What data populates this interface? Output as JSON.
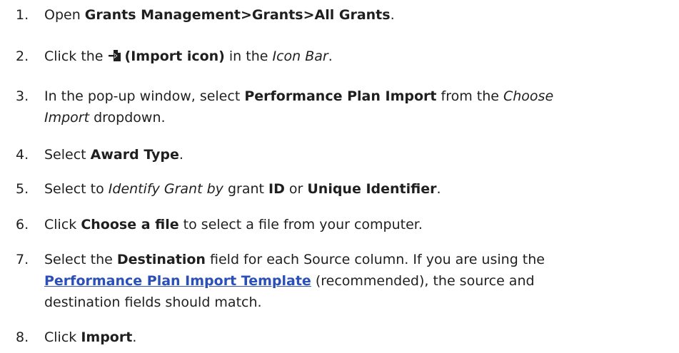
{
  "steps": [
    {
      "number": "1.",
      "pre": "Open ",
      "bold": "Grants Management>Grants>All Grants",
      "post": "."
    },
    {
      "number": "2.",
      "pre": "Click the ",
      "icon": "import-icon",
      "bold": "(Import icon)",
      "mid": " in the ",
      "italic": "Icon Bar",
      "post": "."
    },
    {
      "number": "3.",
      "pre": "In the pop-up window, select ",
      "bold": "Performance Plan Import",
      "mid": " from the ",
      "italic_line1": "Choose",
      "italic_line2": "Import",
      "post": " dropdown."
    },
    {
      "number": "4.",
      "pre": "Select ",
      "bold": "Award Type",
      "post": "."
    },
    {
      "number": "5.",
      "pre": "Select to ",
      "italic": "Identify Grant by",
      "mid": " grant ",
      "bold1": "ID",
      "mid2": " or ",
      "bold2": "Unique Identifier",
      "post": "."
    },
    {
      "number": "6.",
      "pre": "Click ",
      "bold": "Choose a file",
      "post": " to select a file from your computer."
    },
    {
      "number": "7.",
      "pre": "Select the ",
      "bold": "Destination",
      "mid": " field for each Source column. If you are using the",
      "link": "Performance Plan Import Template",
      "post_line2": " (recommended), the source and",
      "line3": "destination fields should match."
    },
    {
      "number": "8.",
      "pre": "Click ",
      "bold": "Import",
      "post": "."
    }
  ],
  "colors": {
    "text": "#1f1f1f",
    "link": "#2a4fb7"
  }
}
